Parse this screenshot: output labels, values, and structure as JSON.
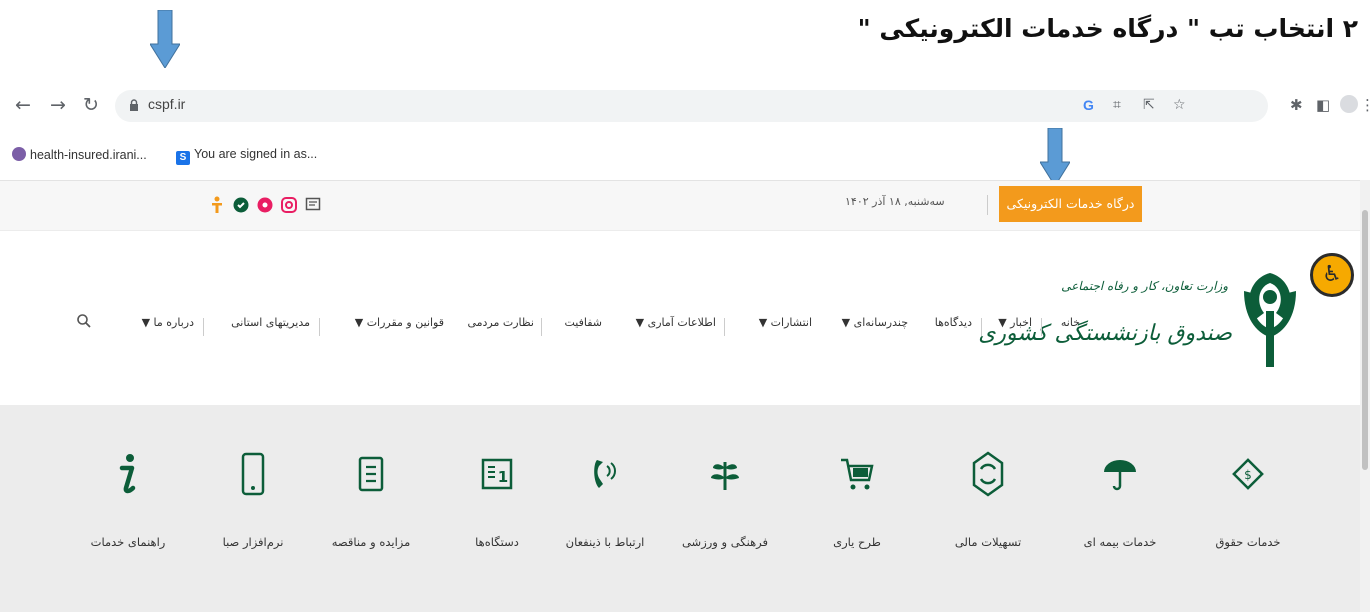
{
  "instruction": "۲ انتخاب تب \" درگاه خدمات الکترونیکی \"",
  "browser": {
    "url": "cspf.ir",
    "bookmarks": [
      {
        "label": "health-insured.irani...",
        "color": "#7b5ea7"
      },
      {
        "label": "You are signed in as...",
        "color": "#1a73e8"
      }
    ]
  },
  "topbar": {
    "portal_tab": "درگاه خدمات الکترونیکی",
    "date": "سه‌شنبه, ۱۸ آذر ۱۴۰۲"
  },
  "nav": {
    "items": [
      {
        "label": "خانه"
      },
      {
        "label": "اخبار ▼"
      },
      {
        "label": "دیدگاه‌ها"
      },
      {
        "label": "چندرسانه‌ای ▼"
      },
      {
        "label": "انتشارات ▼"
      },
      {
        "label": "اطلاعات آماری ▼"
      },
      {
        "label": "شفافیت"
      },
      {
        "label": "نظارت مردمی"
      },
      {
        "label": "قوانین و مقررات ▼"
      },
      {
        "label": "مدیریتهای استانی"
      },
      {
        "label": "درباره ما ▼"
      }
    ]
  },
  "logo": {
    "line1": "وزارت تعاون، کار و رفاه اجتماعی",
    "line2": "صندوق بازنشستگی کشوری"
  },
  "services": [
    {
      "label": "خدمات حقوق",
      "icon": "pay-slip-icon"
    },
    {
      "label": "خدمات بیمه ای",
      "icon": "umbrella-icon"
    },
    {
      "label": "تسهیلات مالی",
      "icon": "finance-icon"
    },
    {
      "label": "طرح یاری",
      "icon": "cart-icon"
    },
    {
      "label": "فرهنگی و ورزشی",
      "icon": "plant-icon"
    },
    {
      "label": "ارتباط با ذینفعان",
      "icon": "phone-icon"
    },
    {
      "label": "دستگاه‌ها",
      "icon": "id-card-icon"
    },
    {
      "label": "مزایده و مناقصه",
      "icon": "document-icon"
    },
    {
      "label": "نرم‌افزار صبا",
      "icon": "mobile-icon"
    },
    {
      "label": "راهنمای خدمات",
      "icon": "info-icon"
    }
  ],
  "colors": {
    "accent": "#f39a1c",
    "brand_green": "#0c5d39",
    "services_bg": "#ececec",
    "annotation_arrow": "#5b9bd5"
  }
}
